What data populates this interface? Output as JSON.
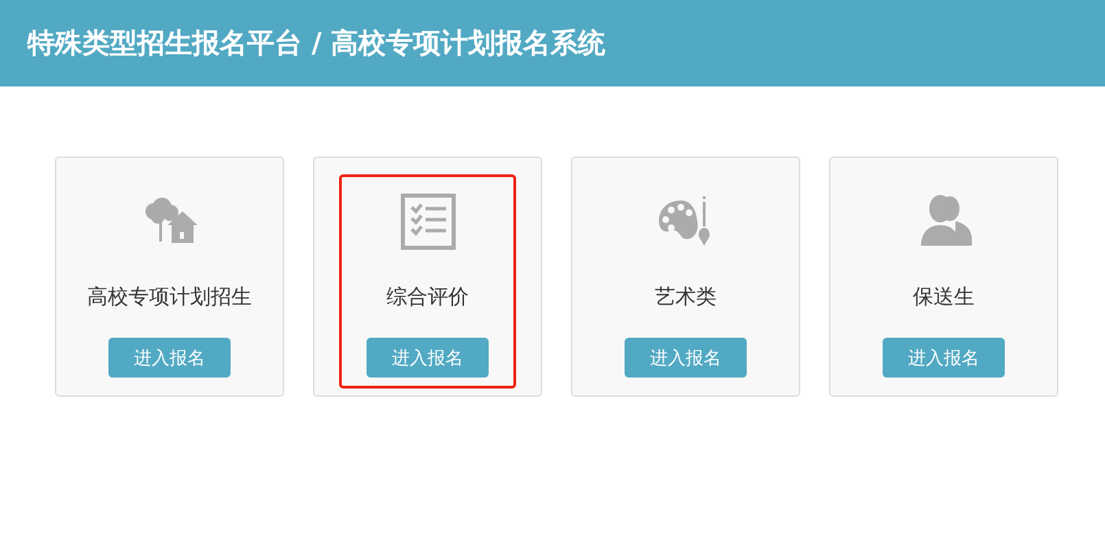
{
  "header": {
    "title": "特殊类型招生报名平台 / 高校专项计划报名系统"
  },
  "cards": [
    {
      "kind": "tree-house",
      "label": "高校专项计划招生",
      "button": "进入报名",
      "highlighted": false
    },
    {
      "kind": "checklist",
      "label": "综合评价",
      "button": "进入报名",
      "highlighted": true
    },
    {
      "kind": "palette",
      "label": "艺术类",
      "button": "进入报名",
      "highlighted": false
    },
    {
      "kind": "users",
      "label": "保送生",
      "button": "进入报名",
      "highlighted": false
    }
  ]
}
